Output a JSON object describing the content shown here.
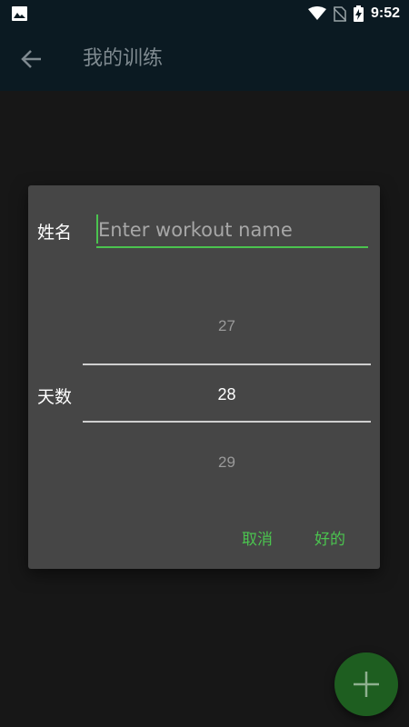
{
  "status_bar": {
    "time": "9:52",
    "icons": [
      "gallery-icon",
      "wifi-icon",
      "no-sim-icon",
      "battery-charging-icon"
    ]
  },
  "app_bar": {
    "title": "我的训练",
    "back_icon": "arrow-left-icon"
  },
  "dialog": {
    "name_label": "姓名",
    "name_placeholder": "Enter workout name",
    "name_value": "",
    "days_label": "天数",
    "picker": {
      "previous": "27",
      "selected": "28",
      "next": "29"
    },
    "cancel_label": "取消",
    "ok_label": "好的"
  },
  "fab": {
    "icon": "plus-icon"
  },
  "colors": {
    "accent": "#4bc44f",
    "app_bar_bg": "#0b1a22",
    "dialog_bg": "#464646",
    "screen_bg": "#171717",
    "fab_bg": "#1e5e20"
  }
}
